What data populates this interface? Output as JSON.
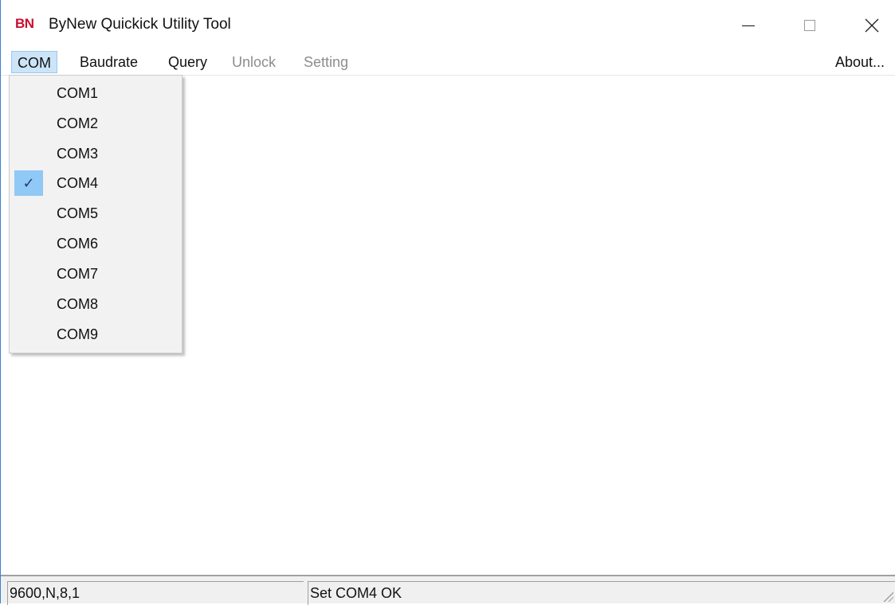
{
  "window": {
    "logo": "BN",
    "title": "ByNew Quickick Utility Tool"
  },
  "menubar": {
    "items": [
      {
        "label": "COM",
        "state": "active"
      },
      {
        "label": "Baudrate",
        "state": "enabled"
      },
      {
        "label": "Query",
        "state": "enabled"
      },
      {
        "label": "Unlock",
        "state": "disabled"
      },
      {
        "label": "Setting",
        "state": "disabled"
      }
    ],
    "about": "About..."
  },
  "com_menu": {
    "items": [
      {
        "label": "COM1",
        "checked": false
      },
      {
        "label": "COM2",
        "checked": false
      },
      {
        "label": "COM3",
        "checked": false
      },
      {
        "label": "COM4",
        "checked": true
      },
      {
        "label": "COM5",
        "checked": false
      },
      {
        "label": "COM6",
        "checked": false
      },
      {
        "label": "COM7",
        "checked": false
      },
      {
        "label": "COM8",
        "checked": false
      },
      {
        "label": "COM9",
        "checked": false
      }
    ],
    "check_glyph": "✓"
  },
  "statusbar": {
    "settings": "9600,N,8,1",
    "message": "Set COM4 OK"
  },
  "colors": {
    "accent_highlight": "#cce4f7",
    "check_bg": "#90c8f6",
    "logo_red": "#c8102e",
    "disabled_text": "#8d8d8d"
  }
}
